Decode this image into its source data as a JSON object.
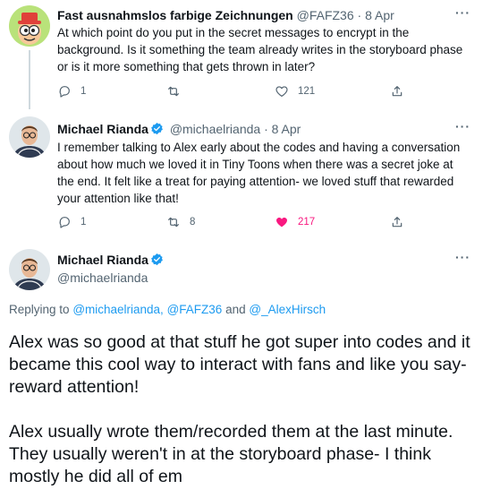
{
  "tweets": [
    {
      "name": "Fast ausnahmslos farbige Zeichnungen",
      "handle": "@FAFZ36",
      "dot": "·",
      "date": "8 Apr",
      "text": "At which point do you put in the secret messages to encrypt in the background. Is it something the team already writes in the storyboard phase or is it more something that gets thrown in later?",
      "replies": "1",
      "retweets": "",
      "likes": "121",
      "more": "···"
    },
    {
      "name": "Michael Rianda",
      "handle": "@michaelrianda",
      "dot": "·",
      "date": "8 Apr",
      "verified": true,
      "text": "I remember talking to Alex early about the codes and having a conversation about how much we loved it in Tiny Toons when there was a secret joke at the end. It felt like a treat for paying attention- we loved stuff that rewarded your attention like that!",
      "replies": "1",
      "retweets": "8",
      "likes": "217",
      "liked": true,
      "more": "···"
    }
  ],
  "main_tweet": {
    "name": "Michael Rianda",
    "handle": "@michaelrianda",
    "more": "···",
    "replying_prefix": "Replying to",
    "replying_mentions": "@michaelrianda, @FAFZ36",
    "replying_and": "and",
    "replying_last": "@_AlexHirsch",
    "paragraph1": "Alex was so good at that stuff he got super into codes and it became this cool way to interact with fans and like you say- reward attention!",
    "paragraph2": "Alex usually wrote them/recorded them at the last minute. They usually weren't in at the storyboard phase- I think mostly he did all of em"
  },
  "colors": {
    "accent": "#1d9bf0",
    "like": "#f91880",
    "muted": "#536471",
    "text": "#0f1419"
  },
  "icons": [
    "reply-icon",
    "retweet-icon",
    "like-icon",
    "share-icon",
    "verified-badge-icon",
    "more-icon"
  ]
}
